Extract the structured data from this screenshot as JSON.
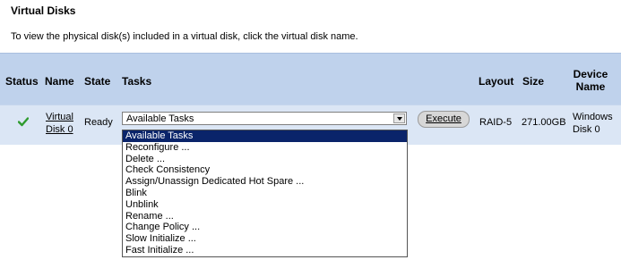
{
  "title": "Virtual Disks",
  "instruction": "To view the physical disk(s) included in a virtual disk, click the virtual disk name.",
  "headers": {
    "status": "Status",
    "name": "Name",
    "state": "State",
    "tasks": "Tasks",
    "layout": "Layout",
    "size": "Size",
    "device_name_line1": "Device",
    "device_name_line2": "Name"
  },
  "row": {
    "status_icon": "checkmark-icon",
    "name_line1": "Virtual",
    "name_line2": "Disk 0",
    "state": "Ready",
    "tasks_selected": "Available Tasks",
    "execute_label": "Execute",
    "layout": "RAID-5",
    "size": "271.00GB",
    "device_line1": "Windows",
    "device_line2": "Disk 0"
  },
  "dropdown_options": [
    "Available Tasks",
    "Reconfigure ...",
    "Delete ...",
    "Check Consistency",
    "Assign/Unassign Dedicated Hot Spare ...",
    "Blink",
    "Unblink",
    "Rename ...",
    "Change Policy ...",
    "Slow Initialize ...",
    "Fast Initialize ..."
  ],
  "colors": {
    "panel": "#bfd2ec",
    "row": "#dbe6f5",
    "selected_option": "#0a246a",
    "check": "#2e9b2e"
  }
}
